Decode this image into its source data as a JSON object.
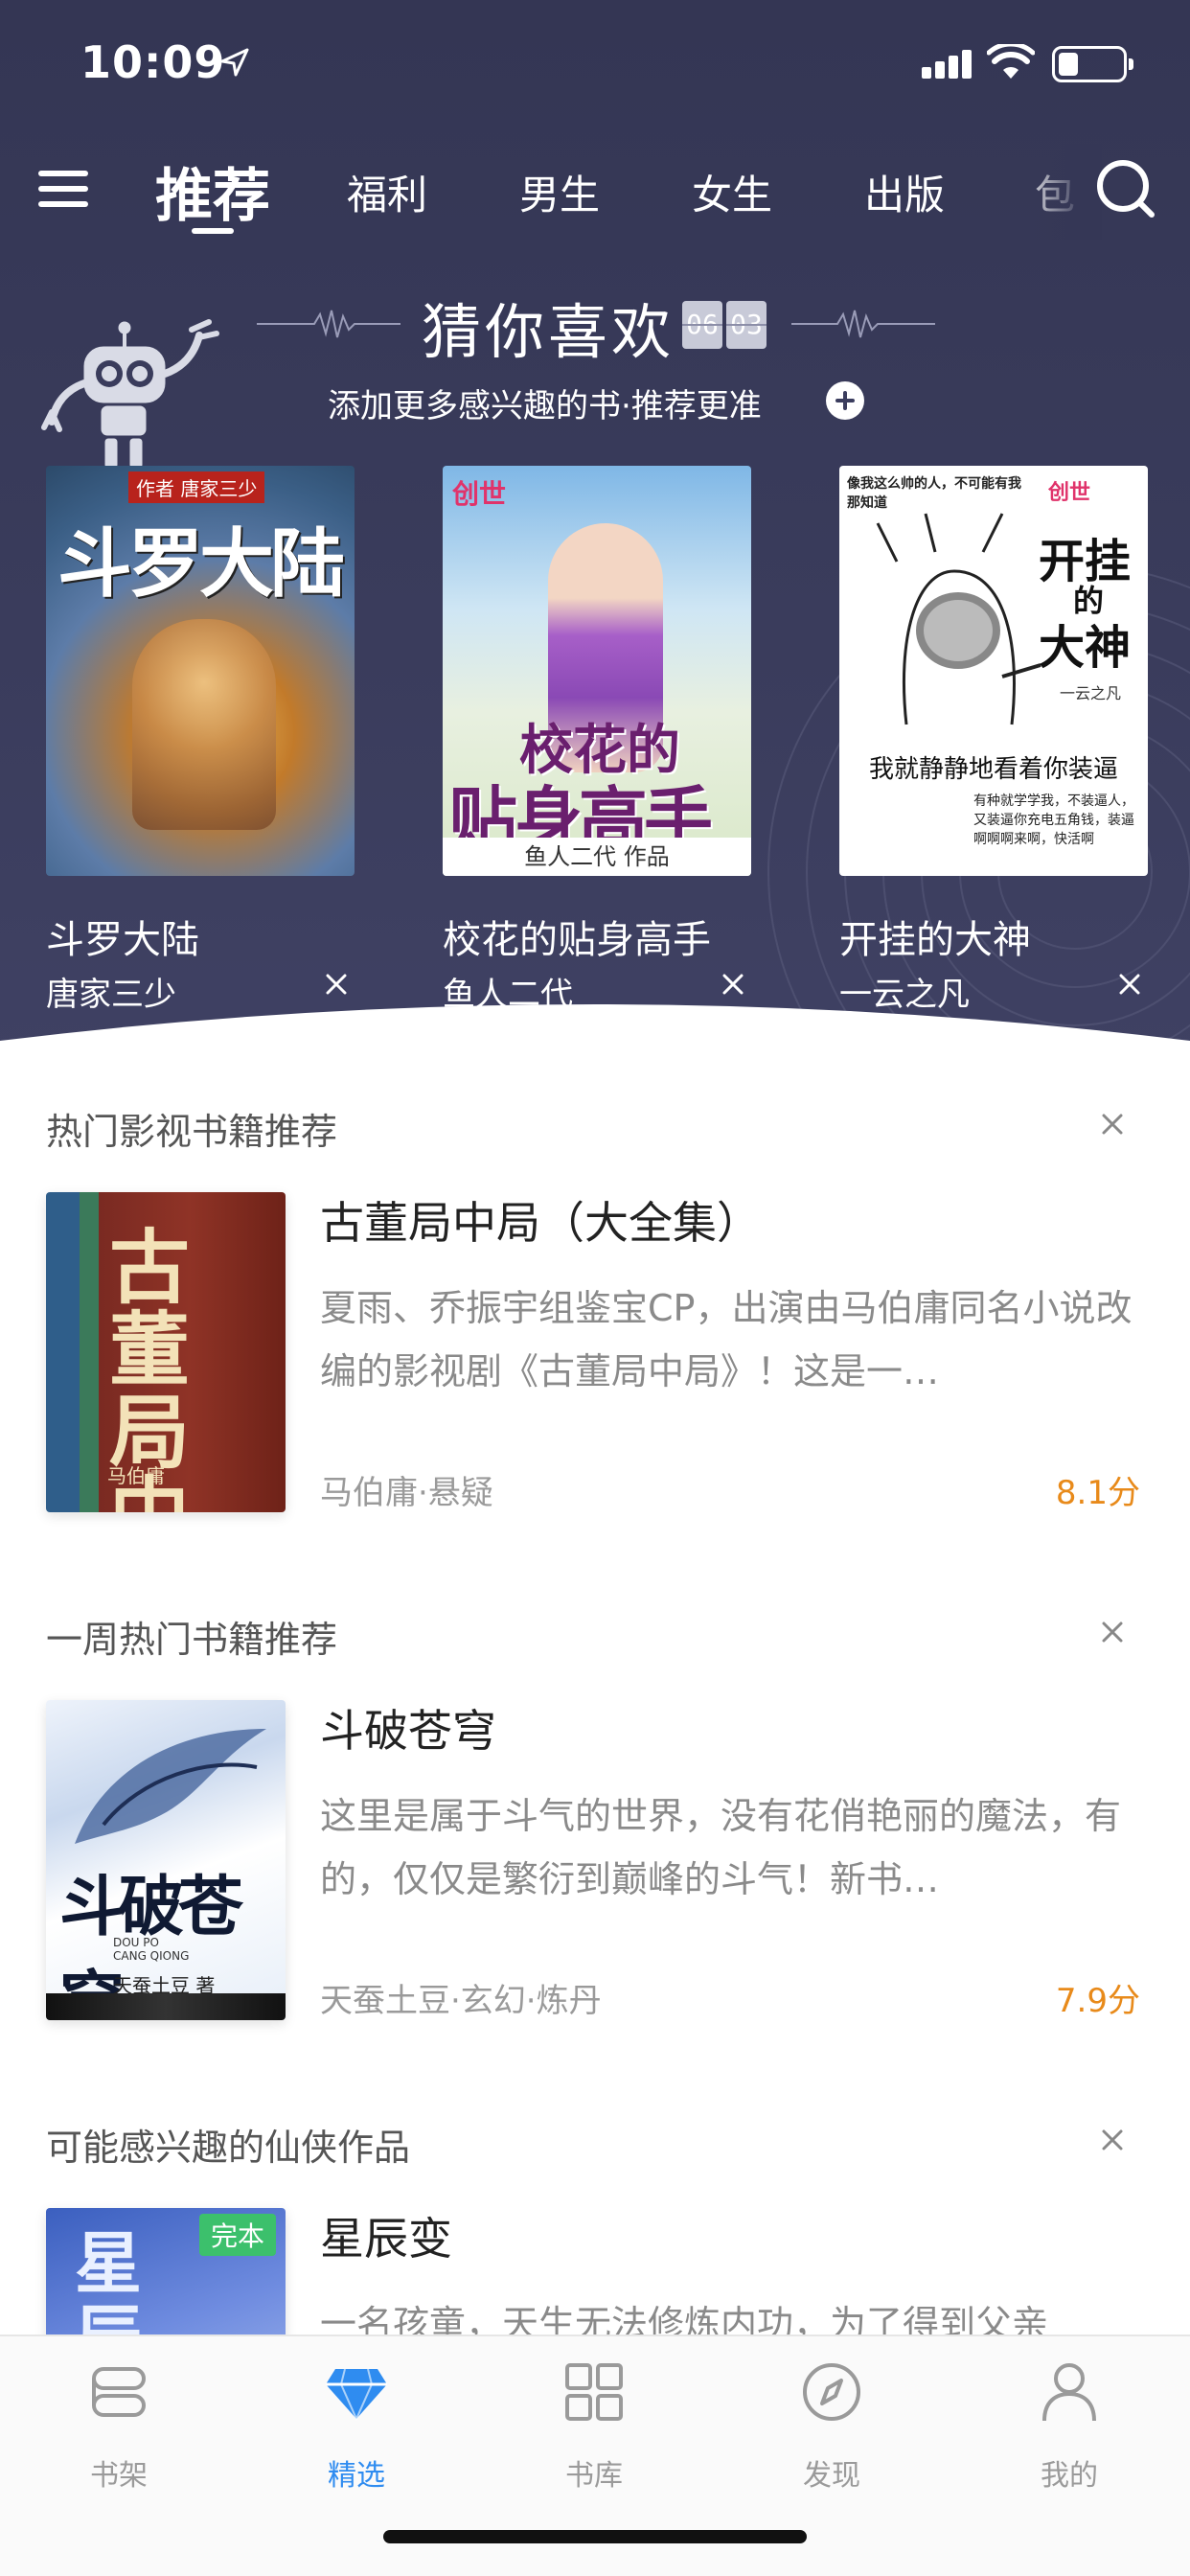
{
  "status_bar": {
    "time": "10:09"
  },
  "top_nav": {
    "tabs": [
      {
        "label": "推荐",
        "active": true
      },
      {
        "label": "福利"
      },
      {
        "label": "男生"
      },
      {
        "label": "女生"
      },
      {
        "label": "出版"
      },
      {
        "label": "包"
      }
    ]
  },
  "guess": {
    "title": "猜你喜欢",
    "date_digits": [
      "06",
      "03"
    ],
    "subtitle": "添加更多感兴趣的书·推荐更准",
    "books": [
      {
        "title": "斗罗大陆",
        "author": "唐家三少",
        "cover_text": "斗罗大陆",
        "cover_tag": "作者 唐家三少"
      },
      {
        "title": "校花的贴身高手",
        "author": "鱼人二代",
        "cover_text_1": "校花的",
        "cover_text_2": "贴身高手",
        "cover_brand": "创世",
        "cover_author": "鱼人二代 作品"
      },
      {
        "title": "开挂的大神",
        "author": "一云之凡",
        "cover_brand": "创世",
        "cover_top": "像我这么帅的人，不可能有我那知道",
        "cover_text_1": "开挂",
        "cover_text_2": "的",
        "cover_text_3": "大神",
        "cover_author": "一云之凡",
        "cover_mid": "我就静静地看着你装逼",
        "cover_bottom": "有种就学学我，不装逼人，又装逼你充电五角钱，装逼啊啊啊来啊，快活啊"
      }
    ]
  },
  "sections": [
    {
      "heading": "热门影视书籍推荐",
      "book": {
        "title": "古董局中局（大全集）",
        "desc": "夏雨、乔振宇组鉴宝CP，出演由马伯庸同名小说改编的影视剧《古董局中局》！这是一…",
        "meta": "马伯庸·悬疑",
        "score": "8.1分",
        "cover_text": "古董局中局",
        "cover_author": "马伯庸"
      }
    },
    {
      "heading": "一周热门书籍推荐",
      "book": {
        "title": "斗破苍穹",
        "desc": "这里是属于斗气的世界，没有花俏艳丽的魔法，有的，仅仅是繁衍到巅峰的斗气！新书…",
        "meta": "天蚕土豆·玄幻·炼丹",
        "score": "7.9分",
        "cover_text": "斗破苍穹",
        "cover_pinyin": "DOU PO CANG QIONG",
        "cover_author": "天蚕土豆 著"
      }
    },
    {
      "heading": "可能感兴趣的仙侠作品",
      "book": {
        "title": "星辰变",
        "desc": "一名孩童，天生无法修炼内功，为了得到父亲",
        "badge": "完本",
        "cover_text": "星辰"
      }
    }
  ],
  "tab_bar": {
    "items": [
      {
        "label": "书架",
        "icon": "bookshelf-icon"
      },
      {
        "label": "精选",
        "icon": "diamond-icon",
        "active": true
      },
      {
        "label": "书库",
        "icon": "grid-icon"
      },
      {
        "label": "发现",
        "icon": "compass-icon"
      },
      {
        "label": "我的",
        "icon": "person-icon"
      }
    ]
  },
  "colors": {
    "hero_bg": "#363856",
    "accent": "#2f8cf0",
    "score": "#e88a1a",
    "badge": "#3cc06c"
  }
}
